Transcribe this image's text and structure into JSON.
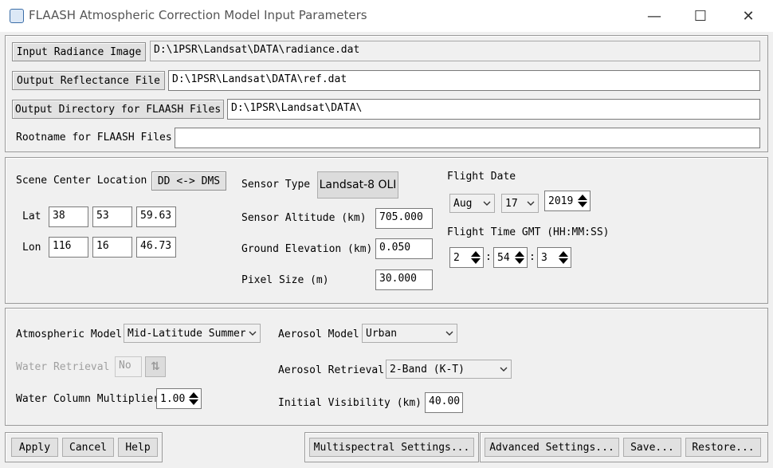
{
  "window": {
    "title": "FLAASH Atmospheric Correction Model Input Parameters",
    "minimize_glyph": "—",
    "maximize_glyph": "☐",
    "close_glyph": "✕"
  },
  "files": {
    "input_radiance_label": "Input Radiance Image",
    "input_radiance_value": "D:\\1PSR\\Landsat\\DATA\\radiance.dat",
    "output_reflectance_label": "Output Reflectance File",
    "output_reflectance_value": "D:\\1PSR\\Landsat\\DATA\\ref.dat",
    "output_directory_label": "Output Directory for FLAASH Files",
    "output_directory_value": "D:\\1PSR\\Landsat\\DATA\\",
    "rootname_label": "Rootname for FLAASH Files",
    "rootname_value": ""
  },
  "scene": {
    "center_label": "Scene Center Location",
    "dd_dms_button": "DD <-> DMS",
    "lat_label": "Lat",
    "lat": [
      "38",
      "53",
      "59.63"
    ],
    "lon_label": "Lon",
    "lon": [
      "116",
      "16",
      "46.73"
    ]
  },
  "sensor": {
    "type_label": "Sensor Type",
    "type_value": "Landsat-8 OLI",
    "altitude_label": "Sensor Altitude (km)",
    "altitude_value": "705.000",
    "ground_label": "Ground Elevation (km)",
    "ground_value": "0.050",
    "pixel_label": "Pixel Size (m)",
    "pixel_value": "30.000"
  },
  "flight": {
    "date_label": "Flight Date",
    "month": "Aug",
    "day": "17",
    "year": "2019",
    "time_label": "Flight Time GMT (HH:MM:SS)",
    "hh": "2",
    "mm": "54",
    "ss": "3",
    "colon": ":"
  },
  "atmosphere": {
    "model_label": "Atmospheric Model",
    "model_value": "Mid-Latitude Summer",
    "water_retrieval_label": "Water Retrieval",
    "water_retrieval_value": "No",
    "water_column_label": "Water Column Multiplier",
    "water_column_value": "1.00",
    "aerosol_model_label": "Aerosol Model",
    "aerosol_model_value": "Urban",
    "aerosol_retrieval_label": "Aerosol Retrieval",
    "aerosol_retrieval_value": "2-Band (K-T)",
    "visibility_label": "Initial Visibility (km)",
    "visibility_value": "40.00"
  },
  "actions": {
    "apply": "Apply",
    "cancel": "Cancel",
    "help": "Help",
    "multispectral": "Multispectral Settings...",
    "advanced": "Advanced Settings...",
    "save": "Save...",
    "restore": "Restore..."
  }
}
